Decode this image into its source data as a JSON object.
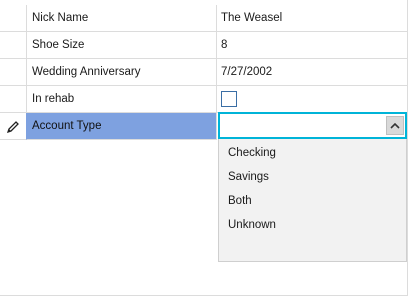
{
  "grid": {
    "rows": [
      {
        "label": "Nick Name",
        "value": "The Weasel"
      },
      {
        "label": "Shoe Size",
        "value": "8"
      },
      {
        "label": "Wedding Anniversary",
        "value": "7/27/2002"
      },
      {
        "label": "In rehab",
        "checked": false
      },
      {
        "label": "Account Type",
        "value": "",
        "selected": true,
        "editing": true
      }
    ]
  },
  "dropdown": {
    "options": [
      "Checking",
      "Savings",
      "Both",
      "Unknown"
    ]
  },
  "icons": {
    "edit_row": "pencil-icon",
    "combo_toggle": "chevron-up-icon"
  },
  "colors": {
    "selection": "#7ea1e0",
    "focus_border": "#00b4d8",
    "checkbox_border": "#3a6ea5",
    "dropdown_bg": "#f2f2f2"
  }
}
